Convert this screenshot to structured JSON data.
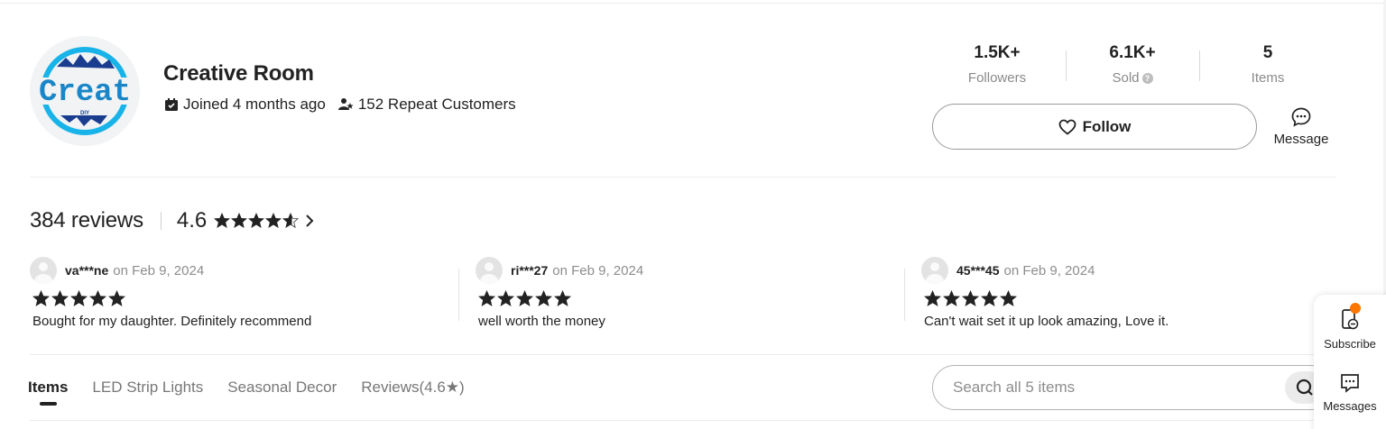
{
  "store": {
    "logo_text": "Creat",
    "logo_subtext": "DIY",
    "name": "Creative Room",
    "joined": "Joined 4 months ago",
    "repeat_customers": "152 Repeat Customers"
  },
  "stats": [
    {
      "value": "1.5K+",
      "label": "Followers"
    },
    {
      "value": "6.1K+",
      "label": "Sold"
    },
    {
      "value": "5",
      "label": "Items"
    }
  ],
  "actions": {
    "follow_label": "Follow",
    "message_label": "Message"
  },
  "reviews_summary": {
    "count_label": "384 reviews",
    "score": "4.6",
    "rating": 4.6,
    "max_rating": 5
  },
  "reviews": [
    {
      "user": "va***ne",
      "date": "on Feb 9, 2024",
      "rating": 5,
      "text": "Bought for my daughter. Definitely recommend"
    },
    {
      "user": "ri***27",
      "date": "on Feb 9, 2024",
      "rating": 5,
      "text": "well worth the money"
    },
    {
      "user": "45***45",
      "date": "on Feb 9, 2024",
      "rating": 5,
      "text": "Can't wait set it up look amazing, Love it."
    }
  ],
  "tabs": [
    {
      "label": "Items",
      "active": true
    },
    {
      "label": "LED Strip Lights",
      "active": false
    },
    {
      "label": "Seasonal Decor",
      "active": false
    },
    {
      "label": "Reviews(4.6★)",
      "active": false
    }
  ],
  "search": {
    "placeholder": "Search all 5 items"
  },
  "rail": {
    "subscribe_label": "Subscribe",
    "messages_label": "Messages"
  },
  "colors": {
    "logo_blue": "#18b3e8",
    "logo_navy": "#1a3d8f",
    "notify_orange": "#fb7701",
    "star": "#222222",
    "muted_text": "#8d8d8d"
  }
}
